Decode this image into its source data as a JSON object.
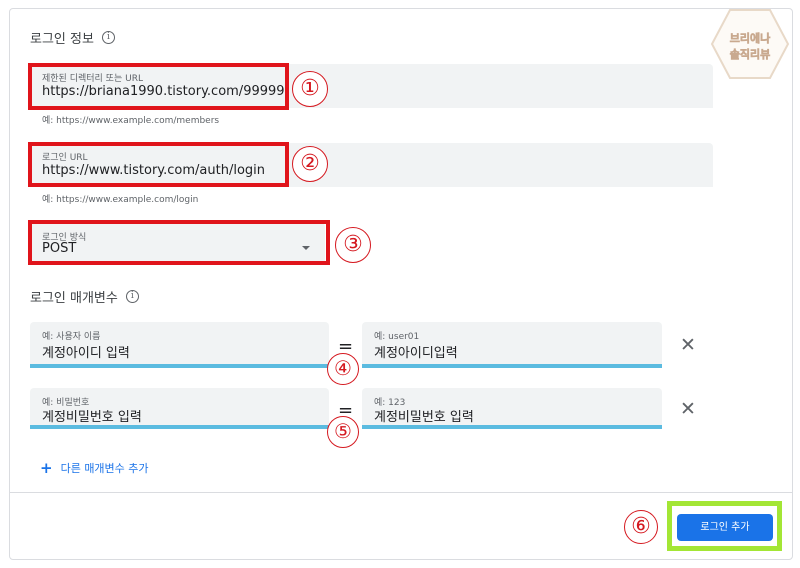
{
  "logo": {
    "line1": "브리에나",
    "line2": "솔직리뷰"
  },
  "login_info": {
    "title": "로그인 정보",
    "info_icon": "i",
    "restricted": {
      "label": "제한된 디렉터리 또는 URL",
      "value": "https://briana1990.tistory.com/99999",
      "helper": "예: https://www.example.com/members"
    },
    "login_url": {
      "label": "로그인 URL",
      "value": "https://www.tistory.com/auth/login",
      "helper": "예: https://www.example.com/login"
    },
    "method": {
      "label": "로그인 방식",
      "value": "POST"
    }
  },
  "params": {
    "title": "로그인 매개변수",
    "info_icon": "i",
    "rows": [
      {
        "name_placeholder": "예: 사용자 이름",
        "name_value": "계정아이디 입력",
        "equals": "=",
        "value_placeholder": "예: user01",
        "value_value": "계정아이디입력",
        "remove": "✕"
      },
      {
        "name_placeholder": "예: 비밀번호",
        "name_value": "계정비밀번호 입력",
        "equals": "=",
        "value_placeholder": "예: 123",
        "value_value": "계정비밀번호 입력",
        "remove": "✕"
      }
    ],
    "add_label": "다른 매개변수 추가",
    "add_icon": "+"
  },
  "annotations": [
    "①",
    "②",
    "③",
    "④",
    "⑤",
    "⑥"
  ],
  "footer": {
    "login_button": "로그인 추가"
  },
  "colors": {
    "annotation_red": "#e0141b",
    "underline_blue": "#5bbbe0",
    "button_blue": "#1a73e8",
    "highlight_green": "#a3e635"
  }
}
